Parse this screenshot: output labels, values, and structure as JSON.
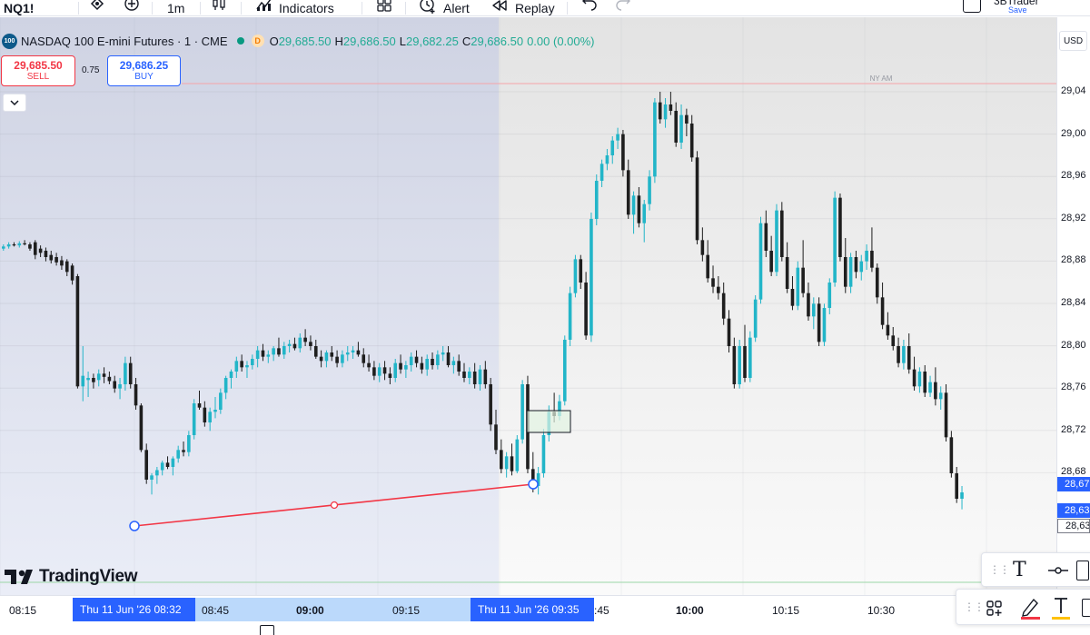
{
  "toolbar": {
    "symbol": "NQ1!",
    "interval": "1m",
    "indicators_label": "Indicators",
    "alert_label": "Alert",
    "replay_label": "Replay",
    "layout_name": "3BTrader",
    "save_label": "Save"
  },
  "legend": {
    "badge": "100",
    "title": "NASDAQ 100 E-mini Futures · 1 · CME",
    "d_badge": "D",
    "o_key": "O",
    "o_val": "29,685.50",
    "h_key": "H",
    "h_val": "29,686.50",
    "l_key": "L",
    "l_val": "29,682.25",
    "c_key": "C",
    "c_val": "29,686.50",
    "change": "0.00 (0.00%)"
  },
  "trade": {
    "sell_price": "29,685.50",
    "sell_label": "SELL",
    "spread": "0.75",
    "buy_price": "29,686.25",
    "buy_label": "BUY"
  },
  "colors": {
    "up": "#22b5c8",
    "down": "#1e1e1e",
    "sell": "#f23645",
    "buy": "#2962ff",
    "session_line": "#f6a4a9"
  },
  "session_label": "NY AM",
  "currency": "USD",
  "price_axis": {
    "ticks": [
      "29,04",
      "29,00",
      "28,96",
      "28,92",
      "28,88",
      "28,84",
      "28,80",
      "28,76",
      "28,72",
      "28,68"
    ],
    "tag_1": "28,67",
    "tag_2": "28,63",
    "tag_3": "28,63"
  },
  "logo_text": "TradingView",
  "time_axis": {
    "labels": [
      {
        "text": "08:15",
        "bold": false
      },
      {
        "text": "08:45",
        "bold": false
      },
      {
        "text": "09:00",
        "bold": true
      },
      {
        "text": "09:15",
        "bold": false
      },
      {
        "text": ":45",
        "bold": false
      },
      {
        "text": "10:00",
        "bold": true
      },
      {
        "text": "10:15",
        "bold": false
      },
      {
        "text": "10:30",
        "bold": false
      }
    ],
    "sel_start": "Thu 11 Jun '26  08:32",
    "sel_end": "Thu 11 Jun '26  09:35"
  },
  "icons": {
    "replay": "replay-icon",
    "alert": "alert-icon",
    "indicators": "indicators-icon",
    "undo": "undo-icon",
    "redo": "redo-icon"
  },
  "chart_data": {
    "type": "candlestick",
    "candles": [
      [
        28892,
        28896,
        28890,
        28894
      ],
      [
        28894,
        28898,
        28892,
        28896
      ],
      [
        28896,
        28898,
        28894,
        28895
      ],
      [
        28895,
        28899,
        28893,
        28897
      ],
      [
        28897,
        28900,
        28895,
        28896
      ],
      [
        28896,
        28898,
        28890,
        28892
      ],
      [
        28898,
        28900,
        28882,
        28886
      ],
      [
        28892,
        28895,
        28884,
        28888
      ],
      [
        28890,
        28893,
        28880,
        28884
      ],
      [
        28886,
        28890,
        28878,
        28881
      ],
      [
        28884,
        28888,
        28876,
        28879
      ],
      [
        28881,
        28885,
        28872,
        28876
      ],
      [
        28880,
        28882,
        28866,
        28870
      ],
      [
        28876,
        28878,
        28858,
        28862
      ],
      [
        28866,
        28868,
        28760,
        28762
      ],
      [
        28762,
        28800,
        28748,
        28772
      ],
      [
        28768,
        28776,
        28752,
        28770
      ],
      [
        28770,
        28774,
        28760,
        28766
      ],
      [
        28768,
        28778,
        28762,
        28774
      ],
      [
        28774,
        28780,
        28765,
        28771
      ],
      [
        28771,
        28776,
        28764,
        28767
      ],
      [
        28767,
        28772,
        28756,
        28760
      ],
      [
        28760,
        28770,
        28750,
        28764
      ],
      [
        28764,
        28790,
        28758,
        28784
      ],
      [
        28784,
        28790,
        28760,
        28764
      ],
      [
        28764,
        28770,
        28740,
        28744
      ],
      [
        28744,
        28746,
        28700,
        28702
      ],
      [
        28702,
        28708,
        28670,
        28674
      ],
      [
        28674,
        28680,
        28660,
        28678
      ],
      [
        28678,
        28686,
        28670,
        28683
      ],
      [
        28683,
        28692,
        28678,
        28690
      ],
      [
        28690,
        28696,
        28684,
        28686
      ],
      [
        28686,
        28696,
        28678,
        28694
      ],
      [
        28694,
        28706,
        28690,
        28702
      ],
      [
        28702,
        28710,
        28696,
        28700
      ],
      [
        28700,
        28720,
        28696,
        28716
      ],
      [
        28716,
        28750,
        28712,
        28746
      ],
      [
        28746,
        28758,
        28740,
        28742
      ],
      [
        28742,
        28748,
        28724,
        28728
      ],
      [
        28728,
        28742,
        28720,
        28738
      ],
      [
        28738,
        28752,
        28732,
        28740
      ],
      [
        28740,
        28760,
        28736,
        28756
      ],
      [
        28756,
        28772,
        28750,
        28770
      ],
      [
        28770,
        28778,
        28760,
        28776
      ],
      [
        28776,
        28790,
        28770,
        28786
      ],
      [
        28786,
        28792,
        28776,
        28780
      ],
      [
        28780,
        28786,
        28770,
        28782
      ],
      [
        28782,
        28792,
        28778,
        28788
      ],
      [
        28788,
        28800,
        28780,
        28796
      ],
      [
        28796,
        28802,
        28786,
        28790
      ],
      [
        28790,
        28796,
        28784,
        28792
      ],
      [
        28792,
        28800,
        28786,
        28798
      ],
      [
        28798,
        28808,
        28790,
        28792
      ],
      [
        28792,
        28804,
        28788,
        28800
      ],
      [
        28800,
        28806,
        28794,
        28802
      ],
      [
        28802,
        28808,
        28796,
        28798
      ],
      [
        28798,
        28812,
        28794,
        28808
      ],
      [
        28808,
        28816,
        28800,
        28804
      ],
      [
        28804,
        28810,
        28796,
        28800
      ],
      [
        28800,
        28806,
        28788,
        28790
      ],
      [
        28790,
        28796,
        28780,
        28786
      ],
      [
        28786,
        28796,
        28780,
        28794
      ],
      [
        28794,
        28800,
        28786,
        28790
      ],
      [
        28790,
        28796,
        28780,
        28784
      ],
      [
        28784,
        28796,
        28780,
        28792
      ],
      [
        28792,
        28800,
        28786,
        28794
      ],
      [
        28794,
        28800,
        28788,
        28796
      ],
      [
        28796,
        28804,
        28790,
        28792
      ],
      [
        28792,
        28798,
        28780,
        28784
      ],
      [
        28784,
        28792,
        28776,
        28780
      ],
      [
        28780,
        28786,
        28768,
        28772
      ],
      [
        28772,
        28784,
        28766,
        28780
      ],
      [
        28780,
        28786,
        28768,
        28774
      ],
      [
        28774,
        28780,
        28764,
        28770
      ],
      [
        28770,
        28788,
        28766,
        28784
      ],
      [
        28784,
        28792,
        28774,
        28778
      ],
      [
        28778,
        28786,
        28770,
        28782
      ],
      [
        28782,
        28794,
        28776,
        28790
      ],
      [
        28790,
        28796,
        28780,
        28784
      ],
      [
        28784,
        28790,
        28774,
        28778
      ],
      [
        28778,
        28792,
        28772,
        28788
      ],
      [
        28788,
        28794,
        28778,
        28782
      ],
      [
        28782,
        28796,
        28778,
        28792
      ],
      [
        28792,
        28800,
        28786,
        28794
      ],
      [
        28794,
        28800,
        28780,
        28782
      ],
      [
        28782,
        28790,
        28774,
        28786
      ],
      [
        28786,
        28792,
        28772,
        28776
      ],
      [
        28776,
        28784,
        28766,
        28770
      ],
      [
        28770,
        28780,
        28764,
        28776
      ],
      [
        28776,
        28784,
        28760,
        28764
      ],
      [
        28764,
        28782,
        28758,
        28778
      ],
      [
        28778,
        28786,
        28760,
        28764
      ],
      [
        28764,
        28770,
        28720,
        28726
      ],
      [
        28726,
        28740,
        28698,
        28702
      ],
      [
        28702,
        28712,
        28680,
        28684
      ],
      [
        28684,
        28700,
        28676,
        28696
      ],
      [
        28696,
        28708,
        28678,
        28682
      ],
      [
        28682,
        28716,
        28680,
        28712
      ],
      [
        28712,
        28768,
        28708,
        28764
      ],
      [
        28764,
        28772,
        28680,
        28684
      ],
      [
        28684,
        28700,
        28662,
        28668
      ],
      [
        28668,
        28686,
        28660,
        28680
      ],
      [
        28680,
        28722,
        28676,
        28716
      ],
      [
        28716,
        28744,
        28710,
        28738
      ],
      [
        28738,
        28756,
        28728,
        28734
      ],
      [
        28734,
        28754,
        28730,
        28748
      ],
      [
        28748,
        28810,
        28744,
        28806
      ],
      [
        28806,
        28856,
        28800,
        28850
      ],
      [
        28850,
        28886,
        28846,
        28882
      ],
      [
        28882,
        28886,
        28854,
        28860
      ],
      [
        28860,
        28870,
        28806,
        28810
      ],
      [
        28810,
        28926,
        28804,
        28920
      ],
      [
        28920,
        28962,
        28914,
        28956
      ],
      [
        28956,
        28976,
        28950,
        28972
      ],
      [
        28972,
        28986,
        28966,
        28980
      ],
      [
        28980,
        28998,
        28972,
        28994
      ],
      [
        28994,
        29006,
        28986,
        29000
      ],
      [
        29000,
        29004,
        28960,
        28966
      ],
      [
        28966,
        28976,
        28920,
        28924
      ],
      [
        28924,
        28946,
        28906,
        28942
      ],
      [
        28942,
        28950,
        28912,
        28916
      ],
      [
        28916,
        28938,
        28898,
        28934
      ],
      [
        28934,
        28966,
        28928,
        28960
      ],
      [
        28960,
        29034,
        28954,
        29030
      ],
      [
        29030,
        29040,
        29010,
        29014
      ],
      [
        29014,
        29034,
        29006,
        29028
      ],
      [
        29028,
        29040,
        29018,
        29022
      ],
      [
        29022,
        29030,
        28988,
        28992
      ],
      [
        28992,
        29028,
        28986,
        29018
      ],
      [
        29018,
        29024,
        28998,
        29010
      ],
      [
        29010,
        29018,
        28974,
        28978
      ],
      [
        28978,
        28984,
        28896,
        28900
      ],
      [
        28900,
        28912,
        28880,
        28886
      ],
      [
        28886,
        28900,
        28860,
        28864
      ],
      [
        28864,
        28876,
        28850,
        28856
      ],
      [
        28856,
        28866,
        28844,
        28850
      ],
      [
        28850,
        28860,
        28820,
        28826
      ],
      [
        28826,
        28834,
        28794,
        28800
      ],
      [
        28800,
        28808,
        28760,
        28764
      ],
      [
        28764,
        28806,
        28760,
        28800
      ],
      [
        28800,
        28820,
        28766,
        28770
      ],
      [
        28770,
        28814,
        28766,
        28808
      ],
      [
        28808,
        28848,
        28804,
        28844
      ],
      [
        28844,
        28922,
        28840,
        28916
      ],
      [
        28916,
        28928,
        28884,
        28890
      ],
      [
        28890,
        28904,
        28866,
        28870
      ],
      [
        28870,
        28934,
        28866,
        28928
      ],
      [
        28928,
        28936,
        28880,
        28884
      ],
      [
        28884,
        28898,
        28850,
        28854
      ],
      [
        28854,
        28866,
        28834,
        28838
      ],
      [
        28838,
        28880,
        28834,
        28874
      ],
      [
        28874,
        28900,
        28846,
        28850
      ],
      [
        28850,
        28860,
        28824,
        28828
      ],
      [
        28828,
        28846,
        28816,
        28840
      ],
      [
        28840,
        28846,
        28800,
        28804
      ],
      [
        28804,
        28840,
        28800,
        28836
      ],
      [
        28836,
        28864,
        28830,
        28860
      ],
      [
        28860,
        28946,
        28856,
        28940
      ],
      [
        28940,
        28944,
        28880,
        28884
      ],
      [
        28884,
        28902,
        28850,
        28856
      ],
      [
        28856,
        28888,
        28850,
        28884
      ],
      [
        28884,
        28890,
        28864,
        28870
      ],
      [
        28870,
        28886,
        28862,
        28880
      ],
      [
        28880,
        28896,
        28872,
        28890
      ],
      [
        28890,
        28912,
        28870,
        28874
      ],
      [
        28874,
        28878,
        28840,
        28846
      ],
      [
        28846,
        28860,
        28816,
        28820
      ],
      [
        28820,
        28832,
        28806,
        28810
      ],
      [
        28810,
        28818,
        28796,
        28800
      ],
      [
        28800,
        28808,
        28780,
        28784
      ],
      [
        28784,
        28806,
        28778,
        28800
      ],
      [
        28800,
        28812,
        28774,
        28778
      ],
      [
        28778,
        28790,
        28758,
        28762
      ],
      [
        28762,
        28780,
        28756,
        28776
      ],
      [
        28776,
        28782,
        28752,
        28756
      ],
      [
        28756,
        28772,
        28752,
        28766
      ],
      [
        28766,
        28780,
        28744,
        28750
      ],
      [
        28750,
        28762,
        28740,
        28756
      ],
      [
        28756,
        28764,
        28710,
        28714
      ],
      [
        28714,
        28720,
        28676,
        28680
      ],
      [
        28680,
        28686,
        28652,
        28656
      ],
      [
        28656,
        28668,
        28646,
        28662
      ]
    ],
    "session_price": 29040
  }
}
